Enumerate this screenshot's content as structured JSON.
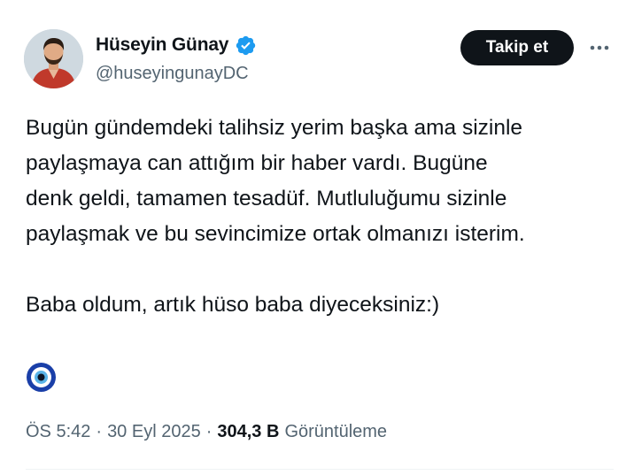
{
  "author": {
    "display_name": "Hüseyin Günay",
    "handle": "@huseyingunayDC",
    "verified": true,
    "verified_color": "#1d9bf0"
  },
  "actions": {
    "follow_label": "Takip et",
    "more_icon": "more-horizontal-icon"
  },
  "tweet": {
    "lines": [
      "Bugün gündemdeki talihsiz yerim başka ama sizinle",
      "paylaşmaya can attığım bir haber vardı. Bugüne",
      "denk geldi, tamamen tesadüf. Mutluluğumu sizinle",
      "paylaşmak ve bu sevincimize ortak olmanızı isterim.",
      "Baba oldum, artık hüso baba diyeceksiniz:)"
    ],
    "emoji": "nazar-boncugu-icon"
  },
  "meta": {
    "time": "ÖS 5:42",
    "separator": "·",
    "date": "30 Eyl 2025",
    "views_count": "304,3 B",
    "views_label": "Görüntüleme"
  },
  "colors": {
    "text": "#0f1419",
    "secondary": "#536471",
    "button_bg": "#0f1419",
    "accent": "#1d9bf0"
  }
}
